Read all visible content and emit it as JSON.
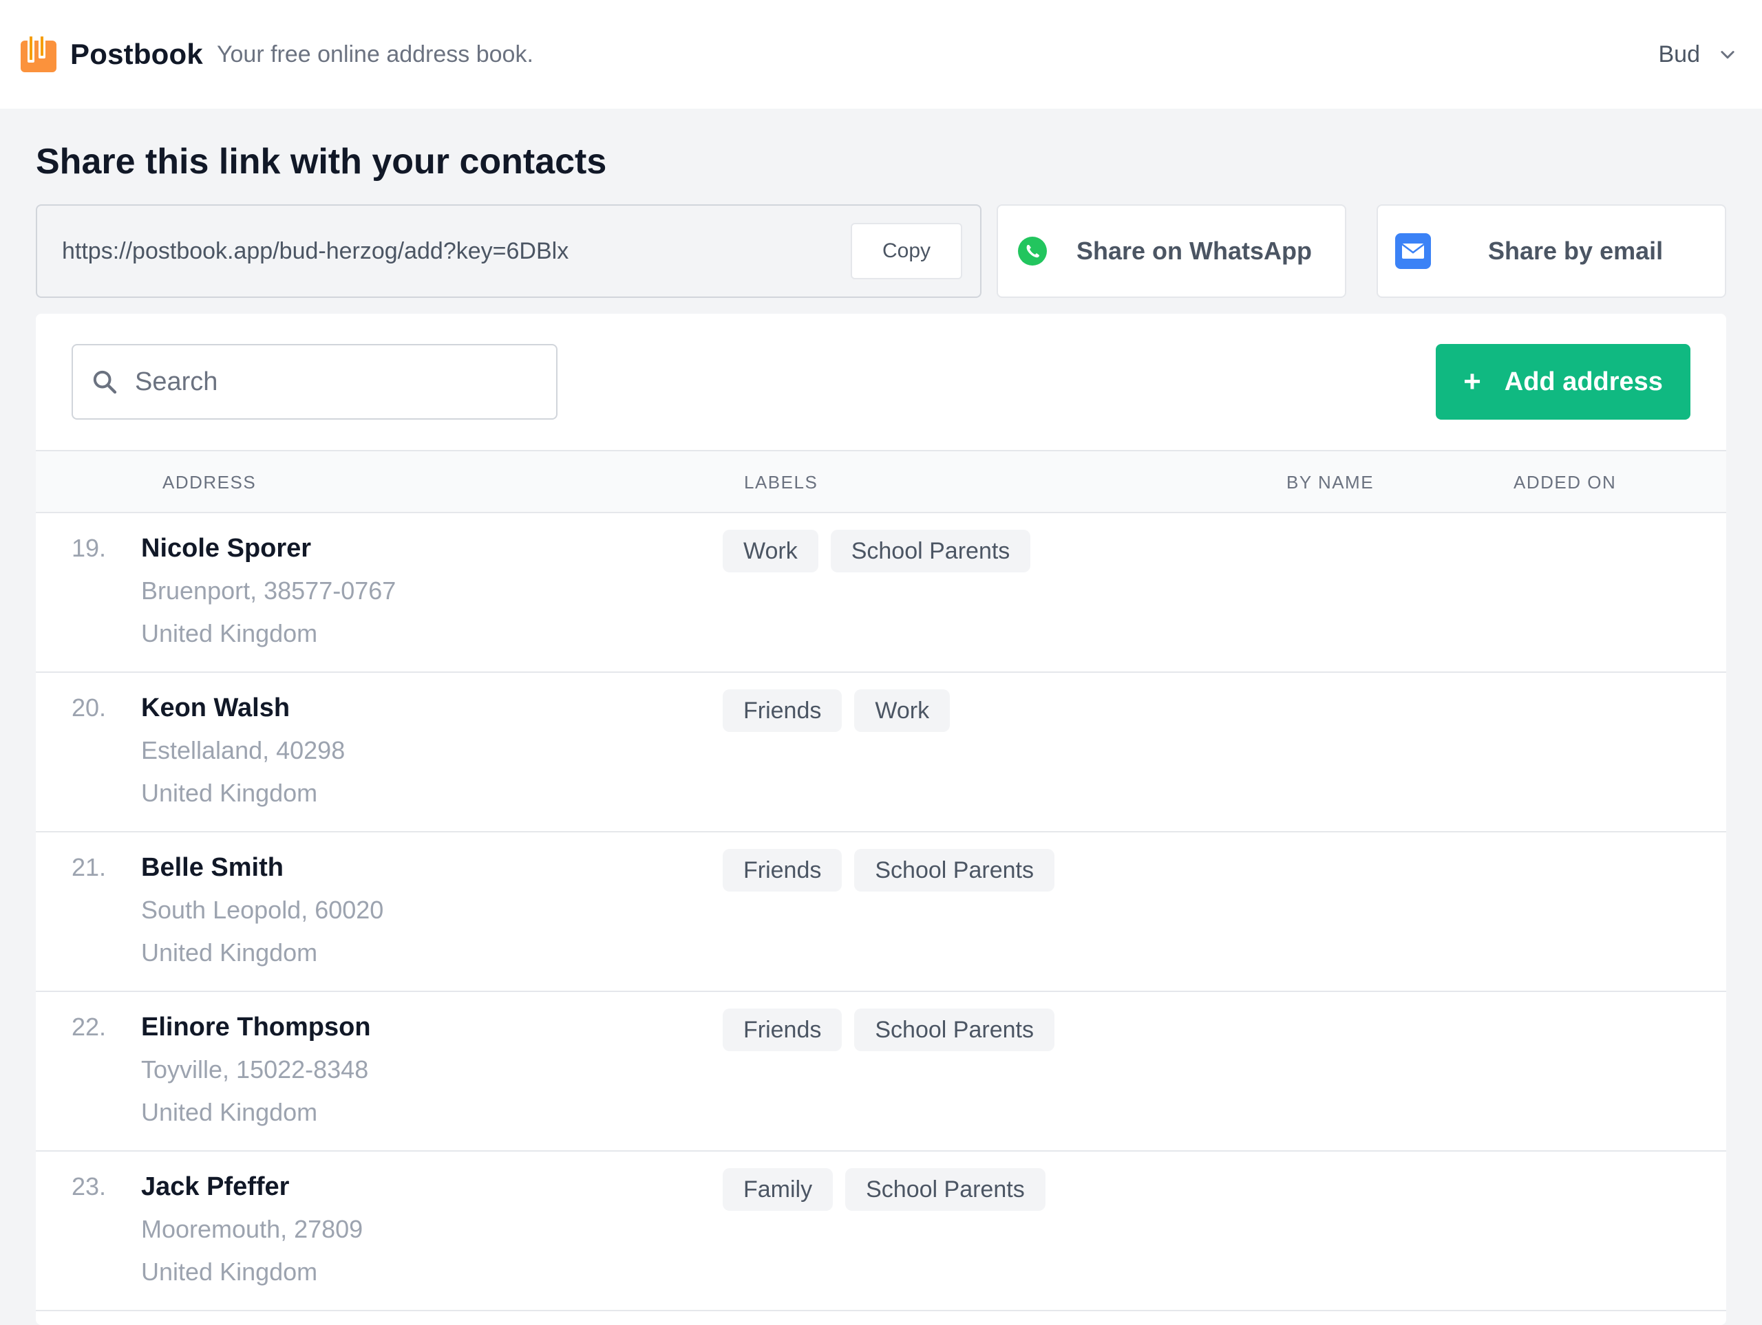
{
  "header": {
    "brand": "Postbook",
    "tagline": "Your free online address book.",
    "user_name": "Bud",
    "logo_color": "#f59e0b"
  },
  "share": {
    "title": "Share this link with your contacts",
    "link": "https://postbook.app/bud-herzog/add?key=6DBlx",
    "copy_label": "Copy",
    "whatsapp_label": "Share on WhatsApp",
    "email_label": "Share by email",
    "whatsapp_color": "#22c55e",
    "email_color": "#3b82f6"
  },
  "toolbar": {
    "search_placeholder": "Search",
    "add_label": "Add address",
    "add_color": "#10b981"
  },
  "table": {
    "columns": [
      "ADDRESS",
      "LABELS",
      "BY NAME",
      "ADDED ON"
    ],
    "rows": [
      {
        "num": "19.",
        "name": "Nicole Sporer",
        "line1": "Bruenport, 38577-0767",
        "line2": "United Kingdom",
        "labels": [
          "Work",
          "School Parents"
        ]
      },
      {
        "num": "20.",
        "name": "Keon Walsh",
        "line1": "Estellaland, 40298",
        "line2": "United Kingdom",
        "labels": [
          "Friends",
          "Work"
        ]
      },
      {
        "num": "21.",
        "name": "Belle Smith",
        "line1": "South Leopold, 60020",
        "line2": "United Kingdom",
        "labels": [
          "Friends",
          "School Parents"
        ]
      },
      {
        "num": "22.",
        "name": "Elinore Thompson",
        "line1": "Toyville, 15022-8348",
        "line2": "United Kingdom",
        "labels": [
          "Friends",
          "School Parents"
        ]
      },
      {
        "num": "23.",
        "name": "Jack Pfeffer",
        "line1": "Mooremouth, 27809",
        "line2": "United Kingdom",
        "labels": [
          "Family",
          "School Parents"
        ]
      }
    ]
  }
}
